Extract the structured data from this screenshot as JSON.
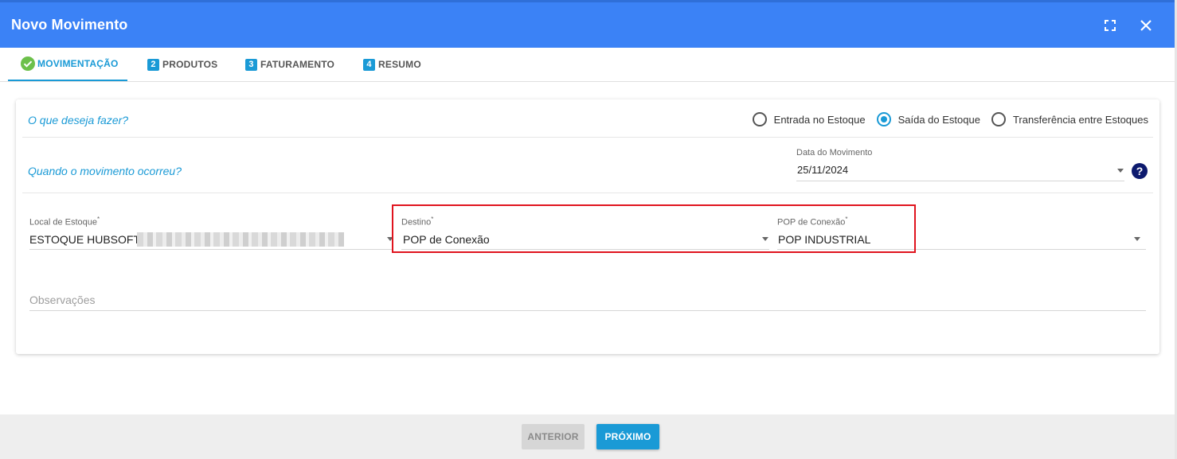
{
  "window": {
    "title": "Novo Movimento",
    "icons": {
      "expand": "expand-icon",
      "close": "close-icon"
    }
  },
  "tabs": [
    {
      "label": "MOVIMENTAÇÃO",
      "marker": "check-circle-icon",
      "active": true
    },
    {
      "label": "PRODUTOS",
      "number": "2"
    },
    {
      "label": "FATURAMENTO",
      "number": "3"
    },
    {
      "label": "RESUMO",
      "number": "4"
    }
  ],
  "form": {
    "question_action": "O que deseja fazer?",
    "radio_options": [
      {
        "label": "Entrada no Estoque",
        "checked": false
      },
      {
        "label": "Saída do Estoque",
        "checked": true
      },
      {
        "label": "Transferência entre Estoques",
        "checked": false
      }
    ],
    "question_when": "Quando o movimento ocorreu?",
    "date_field": {
      "label": "Data do Movimento",
      "value": "25/11/2024",
      "help": "?"
    },
    "local_estoque": {
      "label": "Local de Estoque",
      "required": "*",
      "value": "ESTOQUE HUBSOFT -"
    },
    "destino": {
      "label": "Destino",
      "required": "*",
      "value": "POP de Conexão"
    },
    "pop_conexao": {
      "label": "POP de Conexão",
      "required": "*",
      "value": "POP INDUSTRIAL"
    },
    "observacoes": {
      "placeholder": "Observações"
    }
  },
  "footer": {
    "prev_label": "ANTERIOR",
    "next_label": "PRÓXIMO"
  },
  "colors": {
    "header": "#3b82f6",
    "accent": "#1a9ad6",
    "highlight": "#e0141e",
    "help_icon": "#0d1a6e"
  }
}
